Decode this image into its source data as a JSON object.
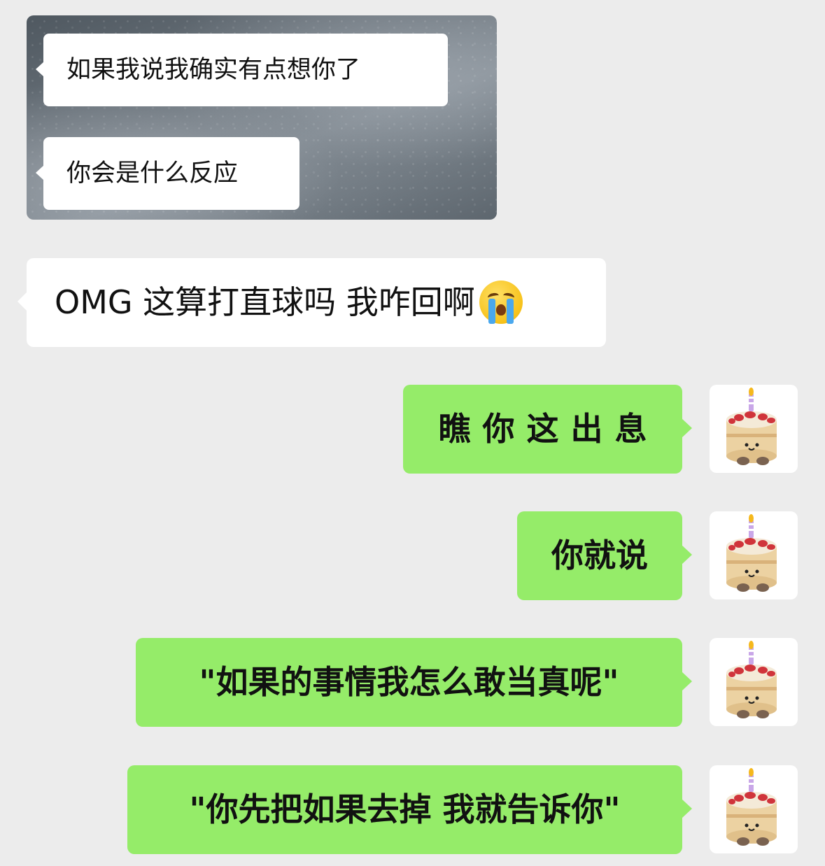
{
  "chat": {
    "screenshot_messages": [
      {
        "text": "如果我说我确实有点想你了"
      },
      {
        "text": "你会是什么反应"
      }
    ],
    "received": {
      "text": "OMG 这算打直球吗 我咋回啊",
      "emoji": "crying-face-icon"
    },
    "sent": [
      {
        "text": "瞧你这出息"
      },
      {
        "text": "你就说"
      },
      {
        "text": "\"如果的事情我怎么敢当真呢\""
      },
      {
        "text": "\"你先把如果去掉 我就告诉你\""
      }
    ],
    "avatar_icon": "birthday-cake-avatar-icon"
  },
  "colors": {
    "background": "#ececec",
    "received_bubble": "#ffffff",
    "sent_bubble": "#95ec69"
  }
}
